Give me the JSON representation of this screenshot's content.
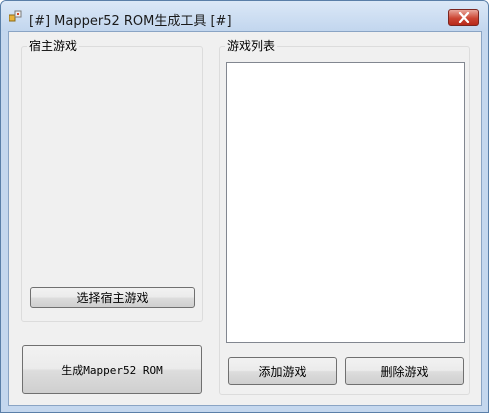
{
  "window": {
    "title": "[#] Mapper52 ROM生成工具 [#]",
    "icons": {
      "app": "app-icon",
      "close": "close-icon"
    }
  },
  "host_group": {
    "title": "宿主游戏",
    "select_button": "选择宿主游戏"
  },
  "generate_button": "生成Mapper52 ROM",
  "game_list_group": {
    "title": "游戏列表",
    "items": [],
    "add_button": "添加游戏",
    "delete_button": "删除游戏"
  },
  "colors": {
    "title_bar": "#c2d6ee",
    "close_button": "#cc4634",
    "client_background": "#f0f0f0"
  }
}
